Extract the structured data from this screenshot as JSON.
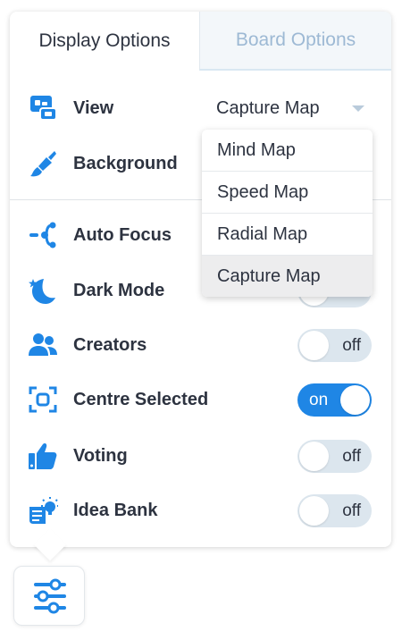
{
  "tabs": {
    "display": "Display Options",
    "board": "Board Options"
  },
  "view": {
    "label": "View",
    "value": "Capture Map"
  },
  "background": {
    "label": "Background"
  },
  "dropdown": {
    "options": [
      "Mind Map",
      "Speed Map",
      "Radial Map",
      "Capture Map"
    ],
    "selected": "Capture Map"
  },
  "toggles": [
    {
      "label": "Auto Focus",
      "icon": "auto-focus-icon"
    },
    {
      "label": "Dark Mode",
      "icon": "moon-icon"
    },
    {
      "label": "Creators",
      "icon": "users-icon",
      "state": "off"
    },
    {
      "label": "Centre Selected",
      "icon": "centre-selected-icon",
      "state": "on"
    },
    {
      "label": "Voting",
      "icon": "thumbs-up-icon",
      "state": "off"
    },
    {
      "label": "Idea Bank",
      "icon": "idea-bank-icon",
      "state": "off"
    }
  ],
  "colors": {
    "accent": "#1f86e5",
    "toggle_off": "#dce6ee",
    "text": "#2d3340",
    "tab_inactive": "#9db9d4"
  },
  "launcher_icon": "sliders-icon"
}
